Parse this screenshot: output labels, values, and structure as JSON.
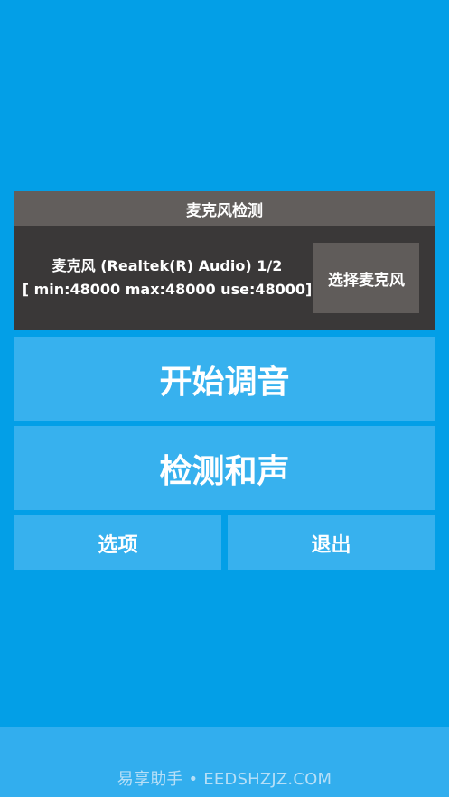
{
  "mic_panel": {
    "title": "麦克风检测",
    "device_line": "麦克风 (Realtek(R) Audio) 1/2",
    "rates_line": "[ min:48000 max:48000 use:48000]",
    "select_button": "选择麦克风"
  },
  "actions": {
    "start_tuning": "开始调音",
    "detect_chord": "检测和声",
    "options": "选项",
    "exit": "退出"
  },
  "footer": {
    "watermark": "易享助手 • EEDSHZJZ.COM"
  },
  "colors": {
    "background": "#039fe7",
    "panel_dark": "#3a3838",
    "panel_header": "#625e5c",
    "button_light": "#37b1ee",
    "footer_bar": "#32aeee"
  }
}
